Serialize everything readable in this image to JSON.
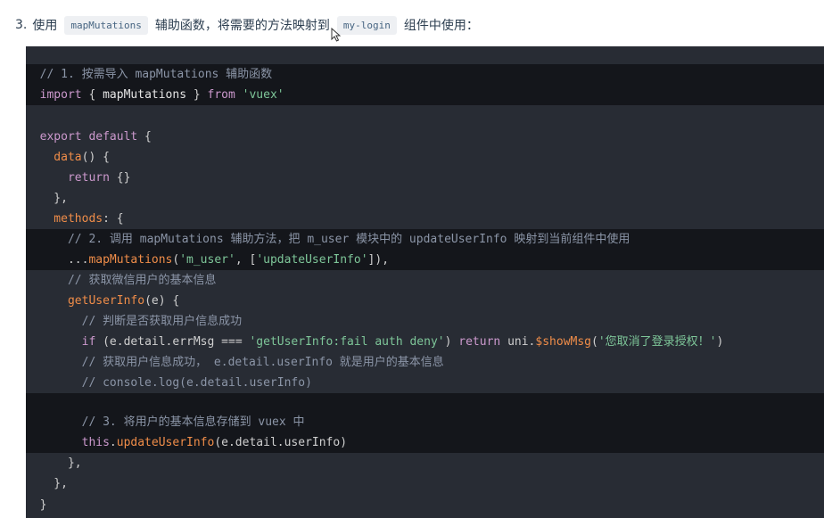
{
  "step": {
    "number": "3.",
    "text_before": "使用",
    "code1": "mapMutations",
    "text_middle": "辅助函数，将需要的方法映射到",
    "code2": "my-login",
    "text_after": "组件中使用："
  },
  "code": {
    "lines": [
      {
        "hl": true,
        "tokens": [
          [
            "c-com",
            "  // 1. 按需导入 mapMutations 辅助函数"
          ]
        ]
      },
      {
        "hl": true,
        "tokens": [
          [
            "c-key",
            "  import"
          ],
          [
            "c-pun",
            " { "
          ],
          [
            "c-id",
            "mapMutations"
          ],
          [
            "c-pun",
            " } "
          ],
          [
            "c-key",
            "from"
          ],
          [
            "c-pun",
            " "
          ],
          [
            "c-str",
            "'vuex'"
          ]
        ]
      },
      {
        "hl": false,
        "tokens": [
          [
            "c-pun",
            ""
          ]
        ]
      },
      {
        "hl": false,
        "tokens": [
          [
            "c-key",
            "  export default"
          ],
          [
            "c-pun",
            " {"
          ]
        ]
      },
      {
        "hl": false,
        "tokens": [
          [
            "c-fn",
            "    data"
          ],
          [
            "c-pun",
            "() {"
          ]
        ]
      },
      {
        "hl": false,
        "tokens": [
          [
            "c-key",
            "      return"
          ],
          [
            "c-pun",
            " {}"
          ]
        ]
      },
      {
        "hl": false,
        "tokens": [
          [
            "c-pun",
            "    },"
          ]
        ]
      },
      {
        "hl": false,
        "tokens": [
          [
            "c-fn",
            "    methods"
          ],
          [
            "c-pun",
            ": {"
          ]
        ]
      },
      {
        "hl": true,
        "tokens": [
          [
            "c-com",
            "      // 2. 调用 mapMutations 辅助方法，把 m_user 模块中的 updateUserInfo 映射到当前组件中使用"
          ]
        ]
      },
      {
        "hl": true,
        "tokens": [
          [
            "c-pun",
            "      ..."
          ],
          [
            "c-fn",
            "mapMutations"
          ],
          [
            "c-pun",
            "("
          ],
          [
            "c-str",
            "'m_user'"
          ],
          [
            "c-pun",
            ", ["
          ],
          [
            "c-str",
            "'updateUserInfo'"
          ],
          [
            "c-pun",
            "]),"
          ]
        ]
      },
      {
        "hl": false,
        "tokens": [
          [
            "c-com",
            "      // 获取微信用户的基本信息"
          ]
        ]
      },
      {
        "hl": false,
        "tokens": [
          [
            "c-fn",
            "      getUserInfo"
          ],
          [
            "c-pun",
            "(e) {"
          ]
        ]
      },
      {
        "hl": false,
        "tokens": [
          [
            "c-com",
            "        // 判断是否获取用户信息成功"
          ]
        ]
      },
      {
        "hl": false,
        "tokens": [
          [
            "c-key",
            "        if"
          ],
          [
            "c-pun",
            " (e.detail.errMsg === "
          ],
          [
            "c-str",
            "'getUserInfo:fail auth deny'"
          ],
          [
            "c-pun",
            ") "
          ],
          [
            "c-key",
            "return"
          ],
          [
            "c-pun",
            " uni."
          ],
          [
            "c-fn",
            "$showMsg"
          ],
          [
            "c-pun",
            "("
          ],
          [
            "c-str",
            "'您取消了登录授权！'"
          ],
          [
            "c-pun",
            ")"
          ]
        ]
      },
      {
        "hl": false,
        "tokens": [
          [
            "c-com",
            "        // 获取用户信息成功， e.detail.userInfo 就是用户的基本信息"
          ]
        ]
      },
      {
        "hl": false,
        "tokens": [
          [
            "c-com",
            "        // console.log(e.detail.userInfo)"
          ]
        ]
      },
      {
        "hl": true,
        "tokens": [
          [
            "c-pun",
            ""
          ]
        ]
      },
      {
        "hl": true,
        "tokens": [
          [
            "c-com",
            "        // 3. 将用户的基本信息存储到 vuex 中"
          ]
        ]
      },
      {
        "hl": true,
        "tokens": [
          [
            "c-key",
            "        this"
          ],
          [
            "c-pun",
            "."
          ],
          [
            "c-fn",
            "updateUserInfo"
          ],
          [
            "c-pun",
            "(e.detail.userInfo)"
          ]
        ]
      },
      {
        "hl": false,
        "tokens": [
          [
            "c-pun",
            "      },"
          ]
        ]
      },
      {
        "hl": false,
        "tokens": [
          [
            "c-pun",
            "    },"
          ]
        ]
      },
      {
        "hl": false,
        "tokens": [
          [
            "c-pun",
            "  }"
          ]
        ]
      }
    ]
  }
}
